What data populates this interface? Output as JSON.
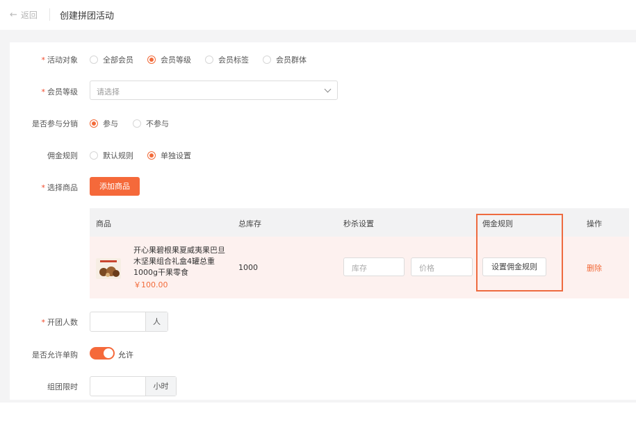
{
  "header": {
    "back_label": "返回",
    "title": "创建拼团活动"
  },
  "form": {
    "target": {
      "label": "活动对象",
      "options": [
        "全部会员",
        "会员等级",
        "会员标签",
        "会员群体"
      ],
      "selected": "会员等级"
    },
    "level": {
      "label": "会员等级",
      "placeholder": "请选择"
    },
    "distribution": {
      "label": "是否参与分销",
      "options": [
        "参与",
        "不参与"
      ],
      "selected": "参与"
    },
    "commission": {
      "label": "佣金规则",
      "options": [
        "默认规则",
        "单独设置"
      ],
      "selected": "单独设置"
    },
    "goods": {
      "label": "选择商品",
      "add_button": "添加商品"
    },
    "group_size": {
      "label": "开团人数",
      "value": "",
      "unit": "人"
    },
    "single_buy": {
      "label": "是否允许单购",
      "on": true,
      "status": "允许"
    },
    "time_limit": {
      "label": "组团限时",
      "value": "",
      "unit": "小时"
    }
  },
  "table": {
    "columns": [
      "商品",
      "总库存",
      "秒杀设置",
      "佣金规则",
      "操作"
    ],
    "rows": [
      {
        "name": "开心果碧根果夏威夷果巴旦木坚果组合礼盒4罐总重1000g干果零食",
        "price": "￥100.00",
        "stock": "1000",
        "stock_placeholder": "库存",
        "price_placeholder": "价格",
        "commission_button": "设置佣金规则",
        "action": "删除"
      }
    ]
  },
  "colors": {
    "accent": "#f5693a",
    "row_highlight": "#fdf1ef",
    "annotation_box": "#ee6a3f"
  }
}
